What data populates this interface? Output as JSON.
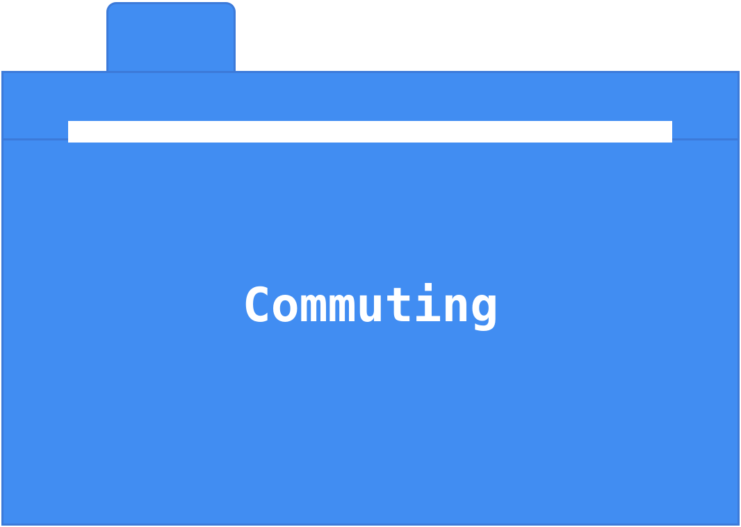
{
  "folder": {
    "label": "Commuting",
    "color": "#418df2",
    "border_color": "#3c7ad9",
    "icon": "folder-icon"
  }
}
